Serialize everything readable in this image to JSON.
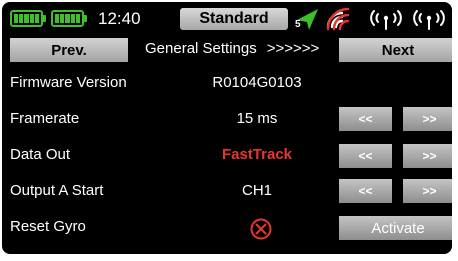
{
  "status_bar": {
    "battery_icons": [
      "battery-full-icon",
      "battery-full-icon"
    ],
    "time": "12:40",
    "model_name": "Standard",
    "gps_icon": "gps-arrow-icon",
    "gps_satellites": "5",
    "signal_icon": "wifi-signal-icon",
    "receiver_icons": [
      "antenna-icon",
      "antenna-icon"
    ]
  },
  "nav": {
    "prev_label": "Prev.",
    "page_title": "General Settings",
    "page_arrows": ">>>>>>",
    "next_label": "Next"
  },
  "rows": [
    {
      "label": "Firmware Version",
      "value": "R0104G0103"
    },
    {
      "label": "Framerate",
      "value": "15 ms",
      "dec_label": "<<",
      "inc_label": ">>"
    },
    {
      "label": "Data Out",
      "value": "FastTrack",
      "value_color": "#e8352e",
      "dec_label": "<<",
      "inc_label": ">>"
    },
    {
      "label": "Output A Start",
      "value": "CH1",
      "dec_label": "<<",
      "inc_label": ">>"
    },
    {
      "label": "Reset Gyro",
      "status_icon": "red-x-circle-icon",
      "action_label": "Activate"
    }
  ],
  "colors": {
    "background": "#000000",
    "accent_green": "#3fbf2a",
    "alert_red": "#e8352e",
    "button_gray": "#a8a8a8"
  }
}
